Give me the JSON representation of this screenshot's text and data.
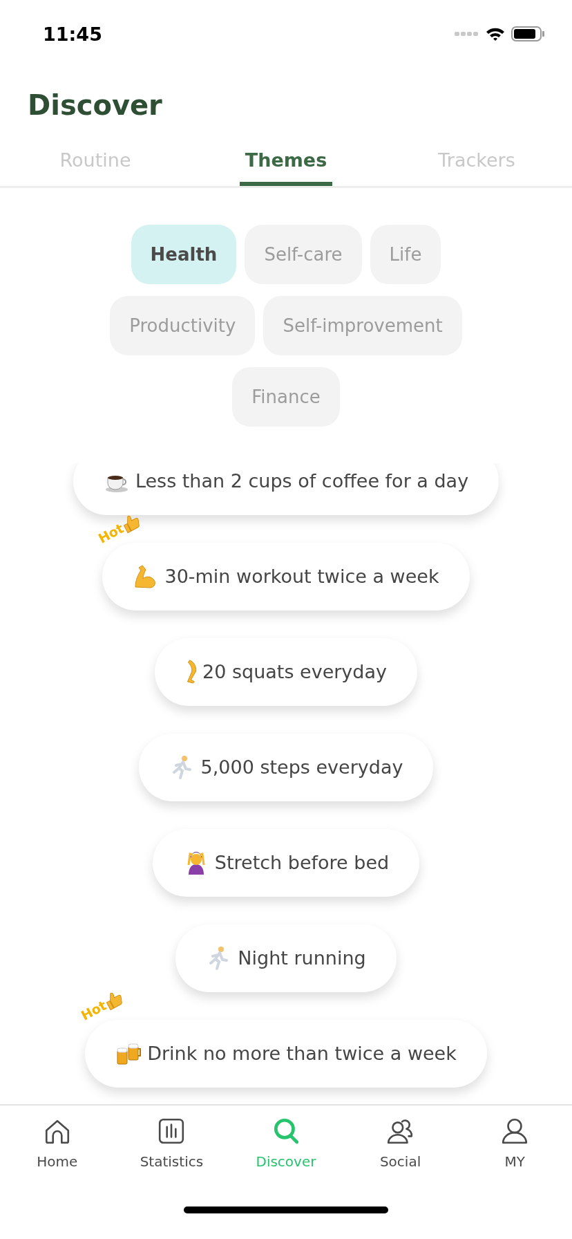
{
  "status_bar": {
    "time": "11:45"
  },
  "header": {
    "title": "Discover"
  },
  "tabs": [
    {
      "label": "Routine",
      "selected": false
    },
    {
      "label": "Themes",
      "selected": true
    },
    {
      "label": "Trackers",
      "selected": false
    }
  ],
  "categories": [
    {
      "label": "Health",
      "selected": true
    },
    {
      "label": "Self-care",
      "selected": false
    },
    {
      "label": "Life",
      "selected": false
    },
    {
      "label": "Productivity",
      "selected": false
    },
    {
      "label": "Self-improvement",
      "selected": false
    },
    {
      "label": "Finance",
      "selected": false
    }
  ],
  "habits": [
    {
      "label": "Less than 2 cups of coffee for a day"
    },
    {
      "label": "30-min workout twice a week",
      "badge": "Hot"
    },
    {
      "label": "20 squats everyday"
    },
    {
      "label": "5,000 steps everyday"
    },
    {
      "label": "Stretch before bed"
    },
    {
      "label": "Night running"
    },
    {
      "label": "Drink no more than twice a week",
      "badge": "Hot"
    }
  ],
  "nav": [
    {
      "label": "Home",
      "selected": false
    },
    {
      "label": "Statistics",
      "selected": false
    },
    {
      "label": "Discover",
      "selected": true
    },
    {
      "label": "Social",
      "selected": false
    },
    {
      "label": "MY",
      "selected": false
    }
  ]
}
